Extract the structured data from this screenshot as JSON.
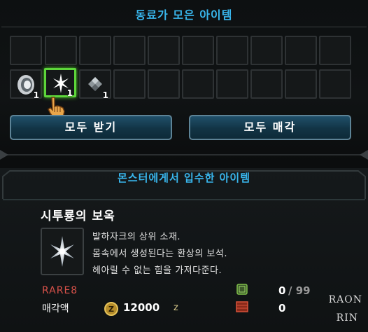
{
  "top_panel": {
    "title": "동료가 모은 아이템",
    "slots_row2": [
      {
        "icon": "shell-icon",
        "count": "1"
      },
      {
        "icon": "star-gem-icon",
        "count": "1",
        "selected": true
      },
      {
        "icon": "ore-icon",
        "count": "1"
      }
    ],
    "buttons": {
      "receive_all": "모두 받기",
      "sell_all": "모두 매각"
    }
  },
  "bottom_panel": {
    "title": "몬스터에게서 입수한 아이템",
    "item": {
      "name": "시투룡의 보옥",
      "icon": "star-gem-icon",
      "description": [
        "발하자크의 상위 소재.",
        "몸속에서 생성된다는 환상의 보석.",
        "헤아릴 수 없는 힘을 가져다준다."
      ],
      "rarity": "RARE8",
      "sell_label": "매각액",
      "sell_price": "12000",
      "currency_unit": "z",
      "pouch_count": "0",
      "pouch_max": "/ 99",
      "box_count": "0"
    }
  },
  "watermark": {
    "line1": "RAON",
    "line2": "RIN"
  },
  "colors": {
    "title_blue": "#39b7ee",
    "rare_red": "#d8524a",
    "select_green": "#5dd63a"
  }
}
